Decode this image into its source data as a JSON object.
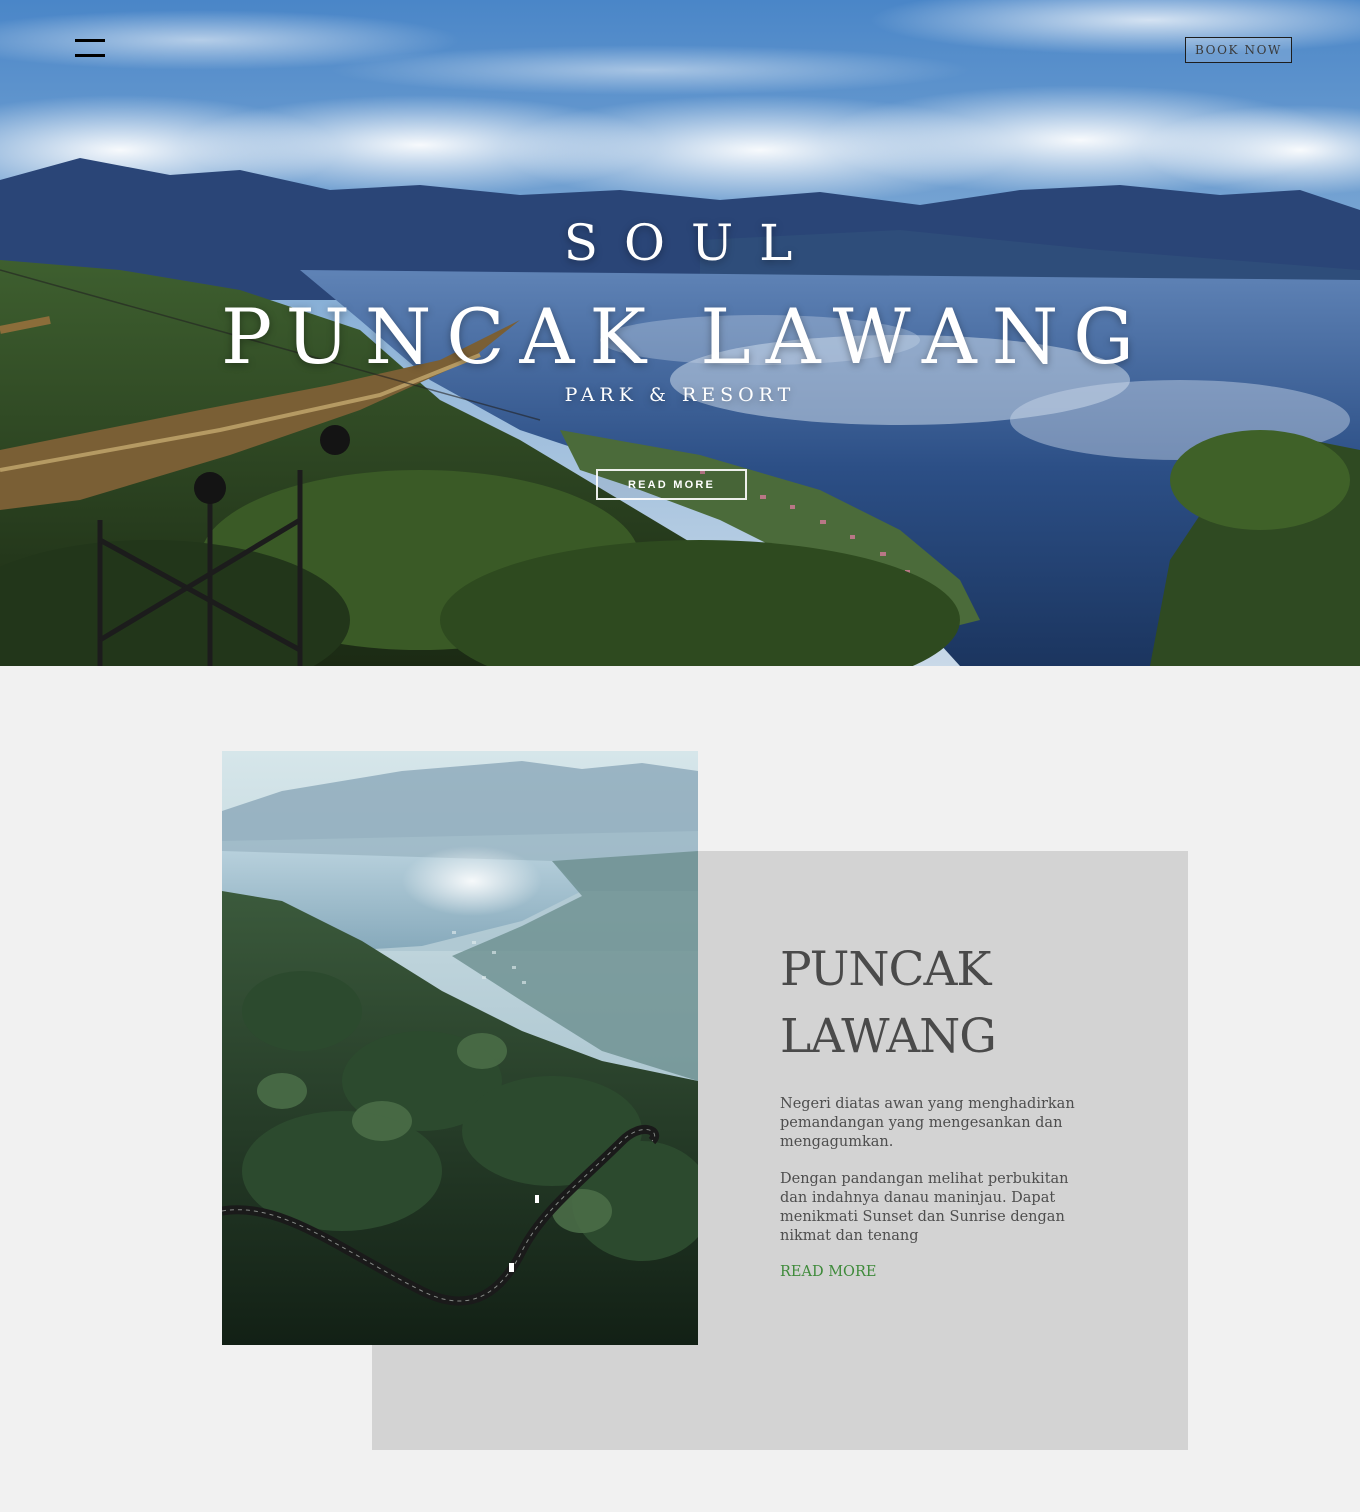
{
  "header": {
    "menu_icon": "hamburger-icon",
    "book_label": "BOOK NOW"
  },
  "hero": {
    "eyebrow": "SOUL",
    "title": "PUNCAK LAWANG",
    "subtitle": "PARK & RESORT",
    "cta_label": "READ MORE"
  },
  "about": {
    "title_line1": "PUNCAK",
    "title_line2": "LAWANG",
    "paragraph1": "Negeri diatas awan yang menghadirkan pemandangan yang mengesankan dan mengagumkan.",
    "paragraph2": "Dengan pandangan melihat perbukitan dan indahnya danau maninjau. Dapat menikmati Sunset dan Sunrise dengan nikmat dan tenang",
    "link_label": "READ MORE"
  },
  "colors": {
    "page_bg": "#f1f1f1",
    "card_bg": "#d3d3d3",
    "link": "#3e8a3a",
    "heading": "#4a4a4a"
  }
}
